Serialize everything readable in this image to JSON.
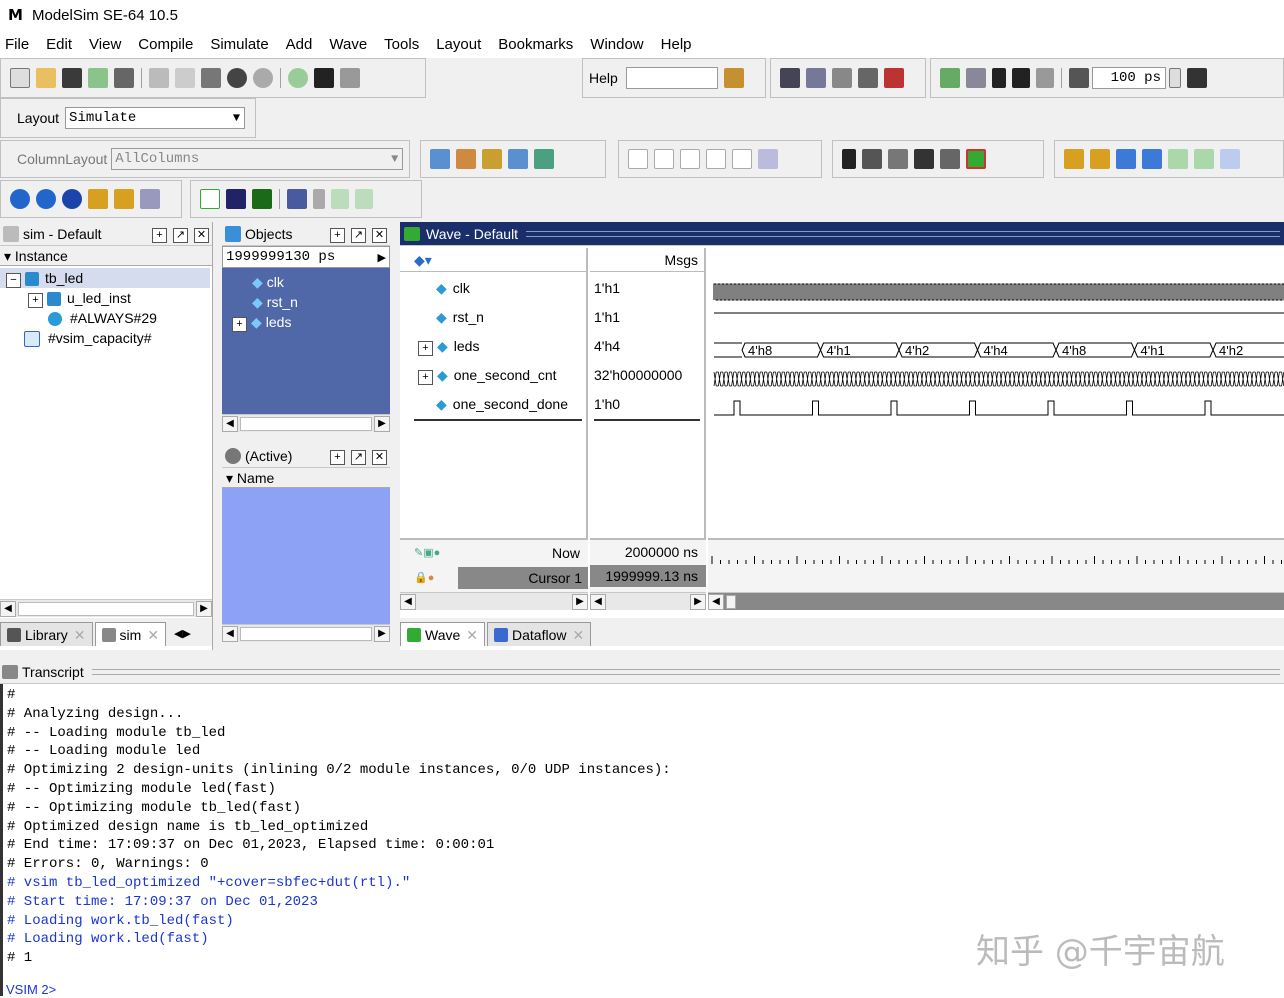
{
  "app": {
    "title": "ModelSim SE-64 10.5",
    "logo": "M"
  },
  "menu": [
    "File",
    "Edit",
    "View",
    "Compile",
    "Simulate",
    "Add",
    "Wave",
    "Tools",
    "Layout",
    "Bookmarks",
    "Window",
    "Help"
  ],
  "toolbar": {
    "help_label": "Help",
    "help_placeholder": "",
    "run_length": "100 ps",
    "layout_label": "Layout",
    "layout_value": "Simulate",
    "column_layout_label": "ColumnLayout",
    "column_layout_value": "AllColumns"
  },
  "sim_pane": {
    "title": "sim - Default",
    "column": "Instance",
    "items": [
      {
        "label": "tb_led",
        "level": 0,
        "expander": "−"
      },
      {
        "label": "u_led_inst",
        "level": 1,
        "expander": "+"
      },
      {
        "label": "#ALWAYS#29",
        "level": 1,
        "expander": ""
      },
      {
        "label": "#vsim_capacity#",
        "level": 0,
        "expander": ""
      }
    ]
  },
  "objects_pane": {
    "title": "Objects",
    "time": "1999999130 ps",
    "items": [
      {
        "label": "clk",
        "expander": ""
      },
      {
        "label": "rst_n",
        "expander": ""
      },
      {
        "label": "leds",
        "expander": "+"
      }
    ]
  },
  "active_pane": {
    "title": "(Active)",
    "column": "Name"
  },
  "wave_pane": {
    "title": "Wave - Default",
    "msgs_header": "Msgs",
    "signals": [
      {
        "name": "clk",
        "value": "1'h1",
        "expander": ""
      },
      {
        "name": "rst_n",
        "value": "1'h1",
        "expander": ""
      },
      {
        "name": "leds",
        "value": "4'h4",
        "expander": "+"
      },
      {
        "name": "one_second_cnt",
        "value": "32'h00000000",
        "expander": "+"
      },
      {
        "name": "one_second_done",
        "value": "1'h0",
        "expander": ""
      }
    ],
    "leds_values": [
      "4'h8",
      "4'h1",
      "4'h2",
      "4'h4",
      "4'h8",
      "4'h1",
      "4'h2"
    ],
    "now_label": "Now",
    "now_value": "2000000 ns",
    "cursor_label": "Cursor 1",
    "cursor_value": "1999999.13 ns"
  },
  "left_tabs": [
    {
      "label": "Library"
    },
    {
      "label": "sim"
    }
  ],
  "wave_tabs": [
    {
      "label": "Wave"
    },
    {
      "label": "Dataflow"
    }
  ],
  "transcript": {
    "title": "Transcript",
    "lines": [
      {
        "text": "#",
        "blue": false
      },
      {
        "text": "# Analyzing design...",
        "blue": false
      },
      {
        "text": "# -- Loading module tb_led",
        "blue": false
      },
      {
        "text": "# -- Loading module led",
        "blue": false
      },
      {
        "text": "# Optimizing 2 design-units (inlining 0/2 module instances, 0/0 UDP instances):",
        "blue": false
      },
      {
        "text": "# -- Optimizing module led(fast)",
        "blue": false
      },
      {
        "text": "# -- Optimizing module tb_led(fast)",
        "blue": false
      },
      {
        "text": "# Optimized design name is tb_led_optimized",
        "blue": false
      },
      {
        "text": "# End time: 17:09:37 on Dec 01,2023, Elapsed time: 0:00:01",
        "blue": false
      },
      {
        "text": "# Errors: 0, Warnings: 0",
        "blue": false
      },
      {
        "text": "# vsim tb_led_optimized \"+cover=sbfec+dut(rtl).\"",
        "blue": true
      },
      {
        "text": "# Start time: 17:09:37 on Dec 01,2023",
        "blue": true
      },
      {
        "text": "# Loading work.tb_led(fast)",
        "blue": true
      },
      {
        "text": "# Loading work.led(fast)",
        "blue": true
      },
      {
        "text": "# 1",
        "blue": false
      }
    ],
    "prompt": "VSIM 2>"
  },
  "watermark": "知乎 @千宇宙航"
}
